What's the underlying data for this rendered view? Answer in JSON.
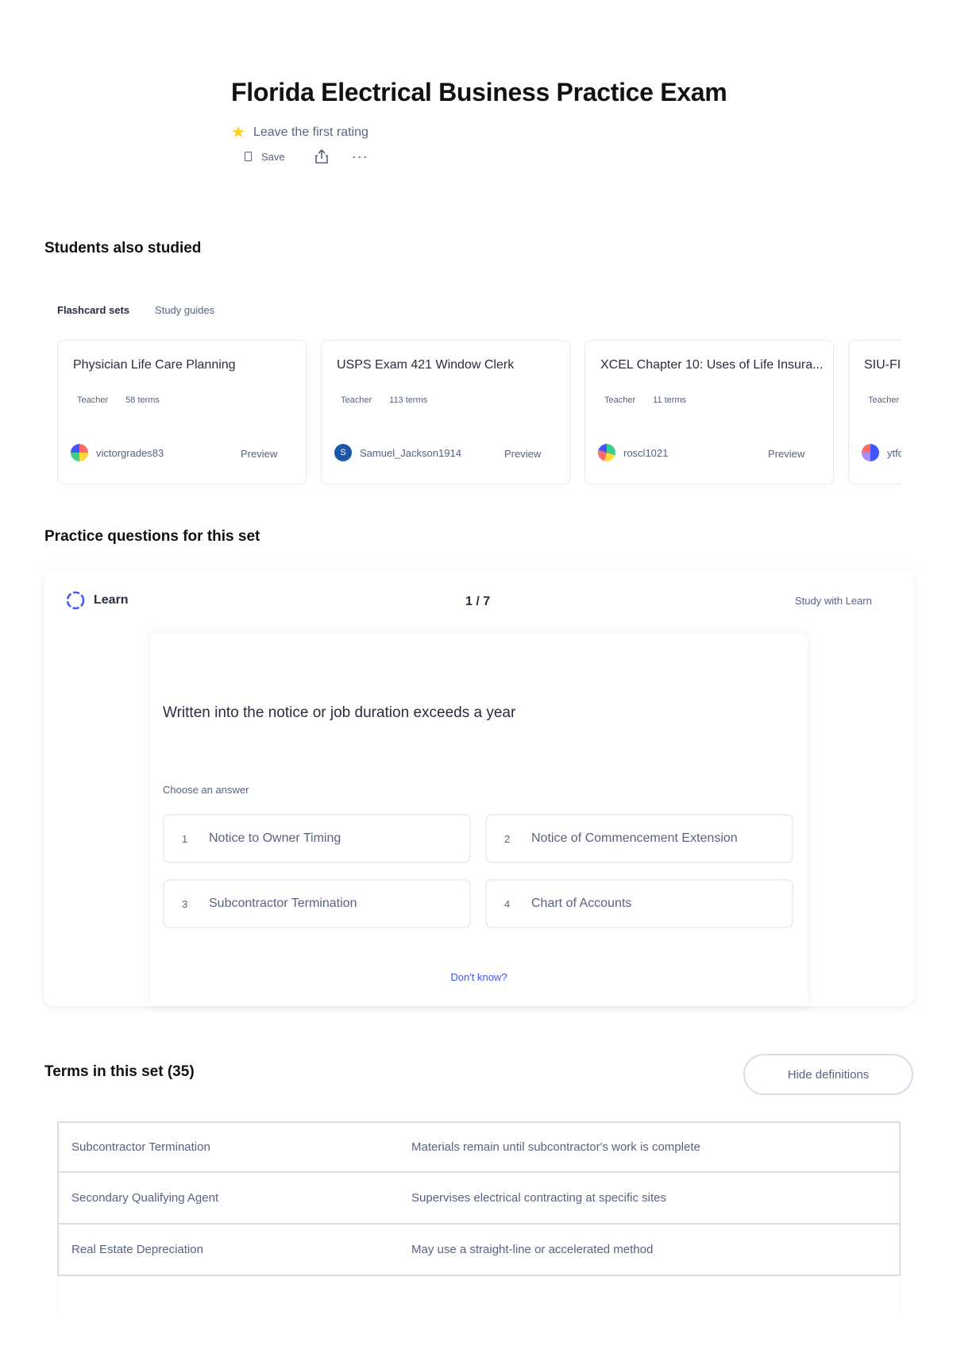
{
  "header": {
    "title": "Florida Electrical Business Practice Exam",
    "rating_text": "Leave the first rating",
    "save_label": "Save",
    "more_label": "···"
  },
  "students_also_studied": {
    "heading": "Students also studied",
    "tabs": [
      {
        "label": "Flashcard sets",
        "active": true
      },
      {
        "label": "Study guides",
        "active": false
      }
    ],
    "cards": [
      {
        "title": "Physician Life Care Planning",
        "role": "Teacher",
        "terms": "58 terms",
        "user": "victorgrades83",
        "avatar_letter": "",
        "preview": "Preview"
      },
      {
        "title": "USPS Exam 421 Window Clerk",
        "role": "Teacher",
        "terms": "113 terms",
        "user": "Samuel_Jackson1914",
        "avatar_letter": "S",
        "preview": "Preview"
      },
      {
        "title": "XCEL Chapter 10: Uses of Life Insura...",
        "role": "Teacher",
        "terms": "11 terms",
        "user": "roscl1021",
        "avatar_letter": "",
        "preview": "Preview"
      },
      {
        "title": "SIU-FIN",
        "role": "Teacher",
        "terms": "",
        "user": "ytfq",
        "avatar_letter": "",
        "preview": ""
      }
    ]
  },
  "practice": {
    "heading": "Practice questions for this set",
    "mode_label": "Learn",
    "counter": "1 / 7",
    "study_link": "Study with Learn",
    "question": "Written into the notice or job duration exceeds a year",
    "choose_label": "Choose an answer",
    "options": [
      {
        "num": "1",
        "text": "Notice to Owner Timing"
      },
      {
        "num": "2",
        "text": "Notice of Commencement Extension"
      },
      {
        "num": "3",
        "text": "Subcontractor Termination"
      },
      {
        "num": "4",
        "text": "Chart of Accounts"
      }
    ],
    "dont_know": "Don't know?"
  },
  "terms": {
    "heading": "Terms in this set (35)",
    "hide_button": "Hide definitions",
    "rows": [
      {
        "term": "Subcontractor Termination",
        "definition": "Materials remain until subcontractor's work is complete"
      },
      {
        "term": "Secondary Qualifying Agent",
        "definition": "Supervises electrical contracting at specific sites"
      },
      {
        "term": "Real Estate Depreciation",
        "definition": "May use a straight-line or accelerated method"
      }
    ]
  },
  "colors": {
    "accent": "#4255ff",
    "text": "#282e3e",
    "muted": "#586380",
    "star": "#ffcd1f",
    "border": "#d9dde8"
  }
}
